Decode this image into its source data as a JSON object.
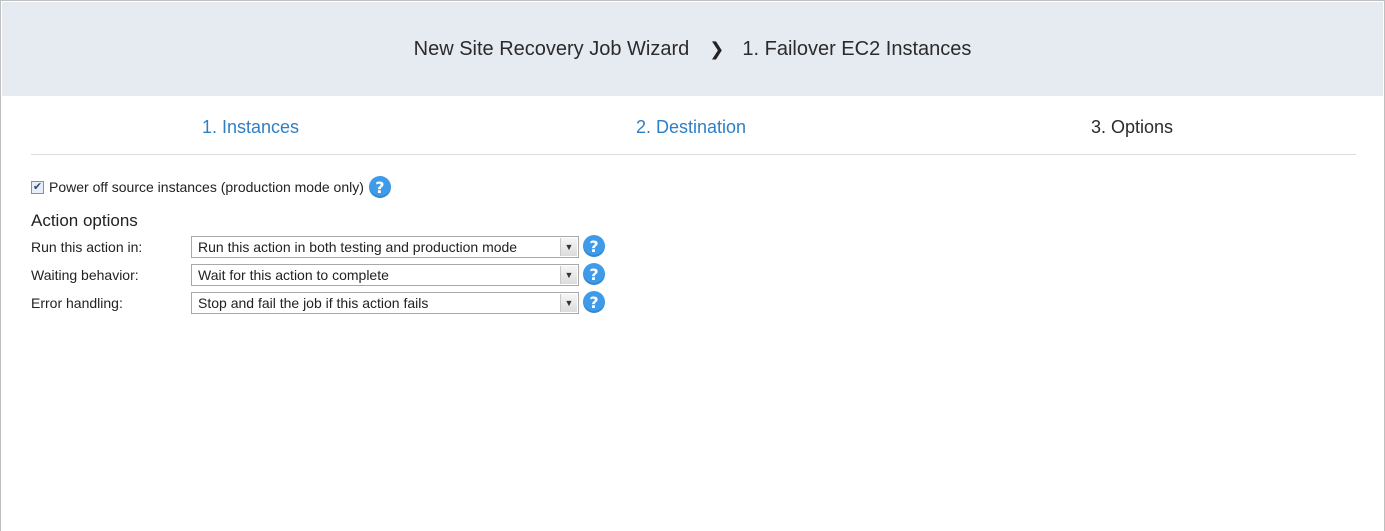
{
  "header": {
    "wizard_title": "New Site Recovery Job Wizard",
    "separator": "›",
    "current_page": "1. Failover EC2 Instances"
  },
  "steps": [
    {
      "label": "1. Instances",
      "state": "link"
    },
    {
      "label": "2. Destination",
      "state": "link"
    },
    {
      "label": "3. Options",
      "state": "current"
    }
  ],
  "power_off": {
    "checked": true,
    "label": "Power off source instances (production mode only)"
  },
  "action_options": {
    "title": "Action options",
    "rows": [
      {
        "label": "Run this action in:",
        "value": "Run this action in both testing and production mode"
      },
      {
        "label": "Waiting behavior:",
        "value": "Wait for this action to complete"
      },
      {
        "label": "Error handling:",
        "value": "Stop and fail the job if this action fails"
      }
    ]
  },
  "icons": {
    "help": "help-icon",
    "dropdown": "chevron-down-icon",
    "check": "check-icon"
  },
  "colors": {
    "header_bg": "#e6eaf1",
    "link": "#2f7fc4",
    "help_icon": "#3d9be9"
  }
}
